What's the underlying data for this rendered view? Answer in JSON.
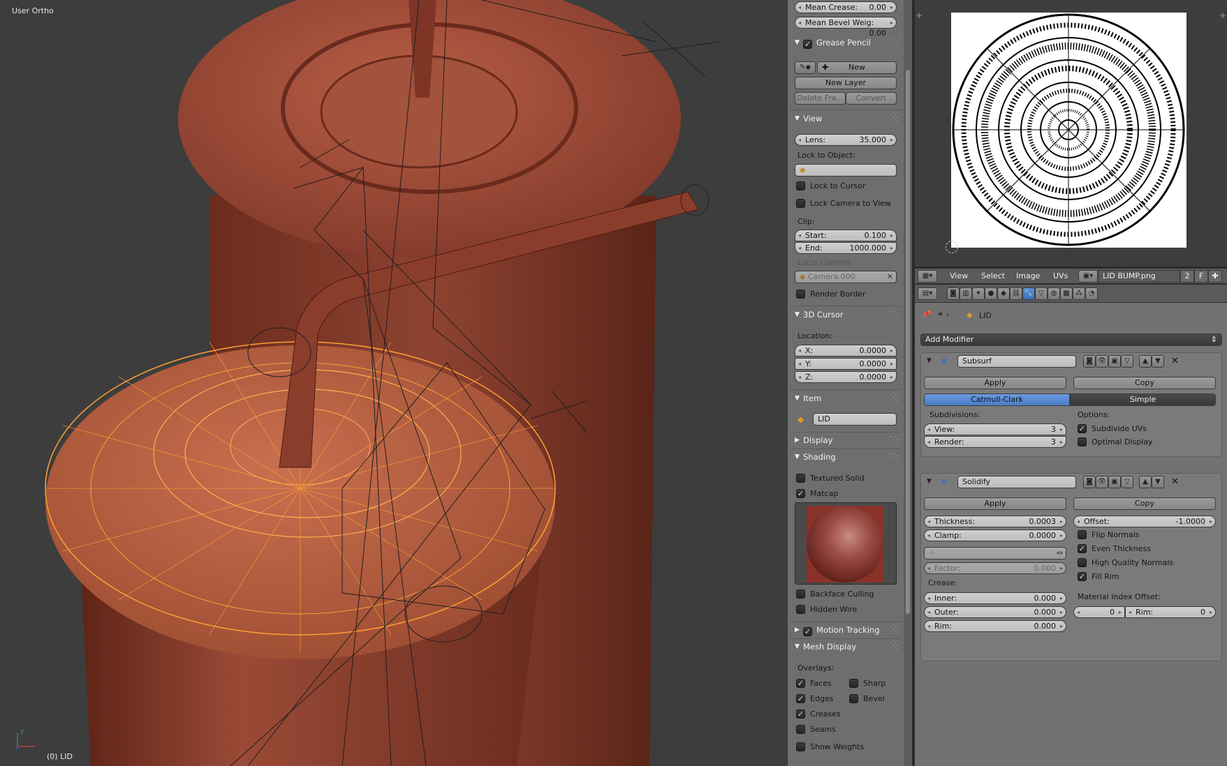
{
  "viewport": {
    "view_label": "User Ortho",
    "object_label": "(0) LID",
    "axis_x": "x",
    "axis_y": "y",
    "colors": {
      "background": "#3d3d3d",
      "cup": "#8b3f2f",
      "lid_selected": "#f08a24",
      "wire": "#1e1e1e"
    }
  },
  "npanel": {
    "mean_crease_label": "Mean Crease:",
    "mean_crease_value": "0.00",
    "mean_bevel_label": "Mean Bevel Weig:",
    "mean_bevel_value": "0.00",
    "grease_pencil": {
      "title": "Grease Pencil",
      "new_label": "New",
      "new_layer_label": "New Layer",
      "delete_frame_label": "Delete Fra...",
      "convert_label": "Convert"
    },
    "view": {
      "title": "View",
      "lens_label": "Lens:",
      "lens_value": "35.000",
      "lock_to_object_label": "Lock to Object:",
      "lock_to_cursor_label": "Lock to Cursor",
      "lock_camera_label": "Lock Camera to View",
      "clip_label": "Clip:",
      "start_label": "Start:",
      "start_value": "0.100",
      "end_label": "End:",
      "end_value": "1000.000",
      "local_camera_label": "Local Camera:",
      "local_camera_value": "Camera.000",
      "render_border_label": "Render Border"
    },
    "cursor3d": {
      "title": "3D Cursor",
      "location_label": "Location:",
      "x_label": "X:",
      "x_value": "0.0000",
      "y_label": "Y:",
      "y_value": "0.0000",
      "z_label": "Z:",
      "z_value": "0.0000"
    },
    "item": {
      "title": "Item",
      "name": "LID"
    },
    "display": {
      "title": "Display"
    },
    "shading": {
      "title": "Shading",
      "textured_solid_label": "Textured Solid",
      "matcap_label": "Matcap",
      "backface_culling_label": "Backface Culling",
      "hidden_wire_label": "Hidden Wire"
    },
    "motion_tracking": {
      "title": "Motion Tracking"
    },
    "mesh_display": {
      "title": "Mesh Display",
      "overlays_label": "Overlays:",
      "faces_label": "Faces",
      "sharp_label": "Sharp",
      "edges_label": "Edges",
      "bevel_label": "Bevel",
      "creases_label": "Creases",
      "seams_label": "Seams",
      "show_weights_label": "Show Weights"
    }
  },
  "image_editor": {
    "menu": {
      "view": "View",
      "select": "Select",
      "image": "Image",
      "uvs": "UVs"
    },
    "image_name": "LID BUMP.png",
    "users_count": "2",
    "fake_user": "F"
  },
  "properties": {
    "object_name": "LID",
    "add_modifier_label": "Add Modifier",
    "subsurf": {
      "name": "Subsurf",
      "apply_label": "Apply",
      "copy_label": "Copy",
      "catmull_label": "Catmull-Clark",
      "simple_label": "Simple",
      "subdivisions_label": "Subdivisions:",
      "options_label": "Options:",
      "view_label": "View:",
      "view_value": "3",
      "render_label": "Render:",
      "render_value": "3",
      "subdivide_uvs_label": "Subdivide UVs",
      "optimal_display_label": "Optimal Display"
    },
    "solidify": {
      "name": "Solidify",
      "apply_label": "Apply",
      "copy_label": "Copy",
      "thickness_label": "Thickness:",
      "thickness_value": "0.0003",
      "offset_label": "Offset:",
      "offset_value": "-1.0000",
      "clamp_label": "Clamp:",
      "clamp_value": "0.0000",
      "flip_normals_label": "Flip Normals",
      "even_thickness_label": "Even Thickness",
      "hq_normals_label": "High Quality Normals",
      "fill_rim_label": "Fill Rim",
      "factor_label": "Factor:",
      "factor_value": "0.000",
      "crease_label": "Crease:",
      "inner_label": "Inner:",
      "inner_value": "0.000",
      "outer_label": "Outer:",
      "outer_value": "0.000",
      "rim_label": "Rim:",
      "rim_value": "0.000",
      "material_index_label": "Material Index Offset:",
      "mat_offset_value": "0",
      "mat_rim_label": "Rim:",
      "mat_rim_value": "0"
    }
  }
}
